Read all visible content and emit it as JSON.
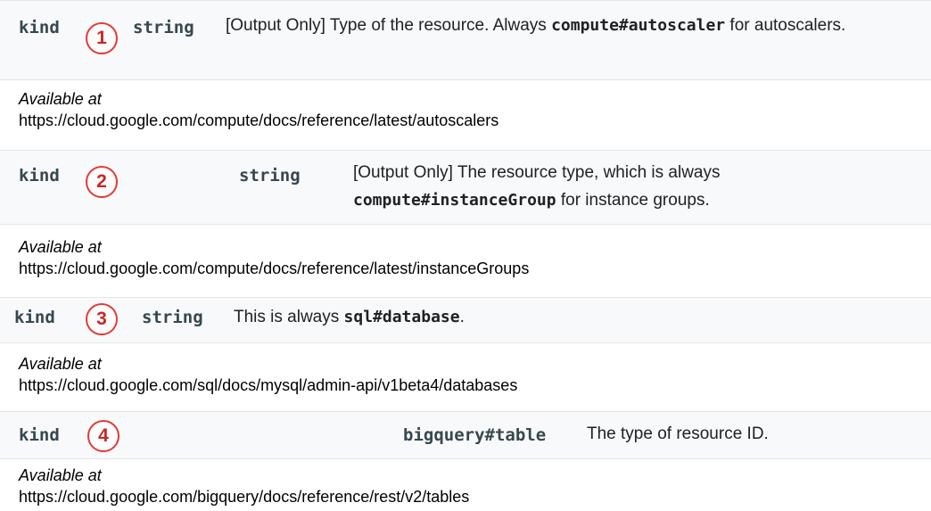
{
  "entries": [
    {
      "number": "1",
      "field": "kind",
      "type": "string",
      "description_pre": "[Output Only] Type of the resource. Always ",
      "description_code": "compute#autoscaler",
      "description_post": " for autoscalers.",
      "available_label": "Available at",
      "url": "https://cloud.google.com/compute/docs/reference/latest/autoscalers"
    },
    {
      "number": "2",
      "field": "kind",
      "type": "string",
      "description_pre": "[Output Only] The resource type, which is always ",
      "description_code": "compute#instanceGroup",
      "description_post": " for instance groups.",
      "available_label": "Available at",
      "url": "https://cloud.google.com/compute/docs/reference/latest/instanceGroups"
    },
    {
      "number": "3",
      "field": "kind",
      "type": "string",
      "description_pre": "This is always ",
      "description_code": "sql#database",
      "description_post": ".",
      "available_label": "Available at",
      "url": "https://cloud.google.com/sql/docs/mysql/admin-api/v1beta4/databases"
    },
    {
      "number": "4",
      "field": "kind",
      "type": "bigquery#table",
      "description_pre": "The type of resource ID.",
      "available_label": "Available at",
      "url": "https://cloud.google.com/bigquery/docs/reference/rest/v2/tables"
    }
  ],
  "colors": {
    "badge": "#e53935",
    "row_bg": "#f8f9fa"
  }
}
